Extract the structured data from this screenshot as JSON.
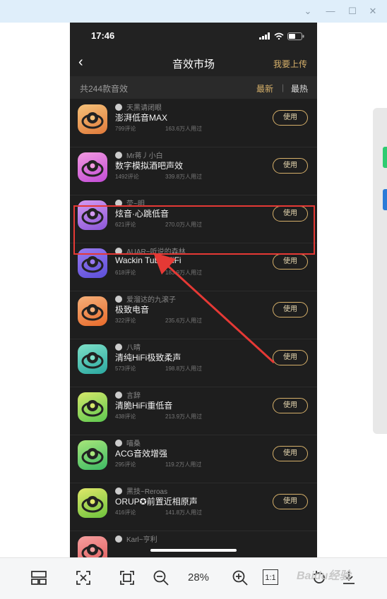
{
  "status": {
    "time": "17:46"
  },
  "nav": {
    "back": "‹",
    "title": "音效市场",
    "upload": "我要上传"
  },
  "subbar": {
    "count": "共244款音效",
    "sort_new": "最新",
    "sort_sep": "|",
    "sort_hot": "最热"
  },
  "items": [
    {
      "author": "天黑请闭眼",
      "name": "澎湃低音MAX",
      "comments": "799评论",
      "users": "163.6万人用过",
      "button": "使用",
      "icon_color": "#e07a3a",
      "icon_color2": "#f6c27a"
    },
    {
      "author": "Mr蒋丿小白",
      "name": "数字模拟酒吧声效",
      "comments": "1492评论",
      "users": "339.8万人用过",
      "button": "使用",
      "icon_color": "#c24bd6",
      "icon_color2": "#f29ae0"
    },
    {
      "author": "荧~明",
      "name": "炫音·心跳低音",
      "comments": "621评论",
      "users": "270.0万人用过",
      "button": "使用",
      "icon_color": "#8a56d8",
      "icon_color2": "#d49af2"
    },
    {
      "author": "AUAR~听说的森林",
      "name": "Wackin Tube HiFi",
      "comments": "618评论",
      "users": "183.9万人用过",
      "button": "使用",
      "icon_color": "#5b4fd8",
      "icon_color2": "#9a7af0"
    },
    {
      "author": "爱溜达的九滚子",
      "name": "极致电音",
      "comments": "322评论",
      "users": "235.6万人用过",
      "button": "使用",
      "icon_color": "#e86a2a",
      "icon_color2": "#f5b07a"
    },
    {
      "author": "八晴",
      "name": "清纯HiFi极致柔声",
      "comments": "573评论",
      "users": "198.8万人用过",
      "button": "使用",
      "icon_color": "#2aa8a0",
      "icon_color2": "#7ee0c8"
    },
    {
      "author": "言辞",
      "name": "清脆HiFi重低音",
      "comments": "438评论",
      "users": "213.9万人用过",
      "button": "使用",
      "icon_color": "#5cc850",
      "icon_color2": "#d6e86a"
    },
    {
      "author": "喵桑",
      "name": "ACG音效增强",
      "comments": "295评论",
      "users": "119.2万人用过",
      "button": "使用",
      "icon_color": "#3cba64",
      "icon_color2": "#a8e67a"
    },
    {
      "author": "黑技~Reroas",
      "name": "ORUP✪前置近相原声",
      "comments": "416评论",
      "users": "141.8万人用过",
      "button": "使用",
      "icon_color": "#6cc23c",
      "icon_color2": "#e0e86a"
    },
    {
      "author": "Karl~亨利",
      "name": "",
      "comments": "",
      "users": "",
      "button": "",
      "icon_color": "#e05a5a",
      "icon_color2": "#f5a0a0"
    }
  ],
  "toolbar": {
    "zoom": "28%",
    "one_to_one": "1:1"
  },
  "watermark": "Baidu经验",
  "colors": {
    "accent": "#d6b06a",
    "highlight": "#e53935",
    "phone_bg": "#1e1e1e"
  }
}
